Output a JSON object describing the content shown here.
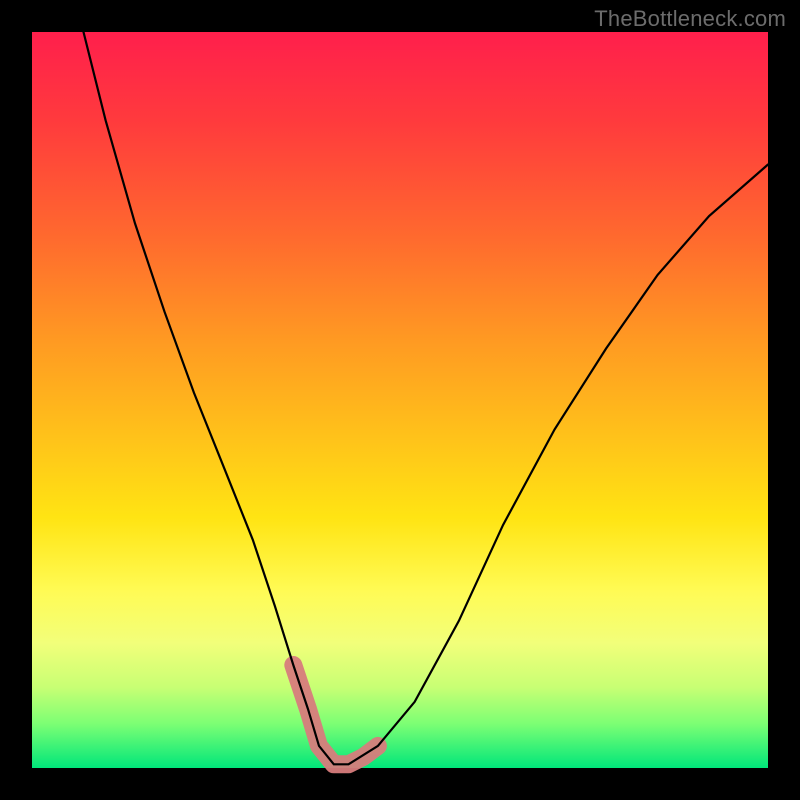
{
  "watermark": "TheBottleneck.com",
  "chart_data": {
    "type": "line",
    "title": "",
    "xlabel": "",
    "ylabel": "",
    "xlim": [
      0,
      100
    ],
    "ylim": [
      0,
      100
    ],
    "grid": false,
    "series": [
      {
        "name": "bottleneck-curve",
        "x": [
          7,
          10,
          14,
          18,
          22,
          26,
          30,
          33,
          35.5,
          37.5,
          39,
          41,
          43,
          47,
          52,
          58,
          64,
          71,
          78,
          85,
          92,
          100
        ],
        "y": [
          100,
          88,
          74,
          62,
          51,
          41,
          31,
          22,
          14,
          8,
          3,
          0.5,
          0.5,
          3,
          9,
          20,
          33,
          46,
          57,
          67,
          75,
          82
        ]
      }
    ],
    "annotations": [
      {
        "name": "valley-highlight",
        "type": "polyline",
        "x": [
          35.5,
          37.5,
          39,
          41,
          43,
          45,
          47
        ],
        "y": [
          14,
          8,
          3,
          0.5,
          0.5,
          1.5,
          3
        ],
        "color": "#d77c7c"
      }
    ]
  }
}
